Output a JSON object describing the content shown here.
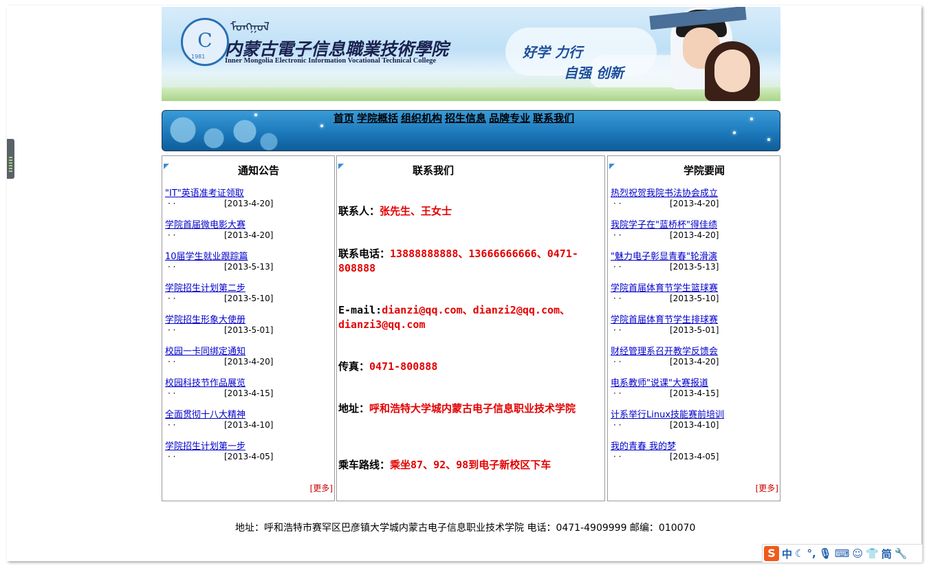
{
  "banner": {
    "cn_college": "内蒙古電子信息職業技術學院",
    "en_college": "Inner Mongolia Electronic Information Vocational Technical College",
    "seal_year": "1981",
    "slogan_1": "好学 力行",
    "slogan_2": "自强 创新"
  },
  "nav": {
    "items": [
      "首页",
      "学院概括",
      "组织机构",
      "招生信息",
      "品牌专业",
      "联系我们"
    ]
  },
  "notices": {
    "title": "通知公告",
    "more": "[更多]",
    "items": [
      {
        "title": "\"IT\"英语准考证领取",
        "date": "[2013-4-20]"
      },
      {
        "title": "学院首届微电影大赛",
        "date": "[2013-4-20]"
      },
      {
        "title": "10届学生就业跟踪篇",
        "date": "[2013-5-13]"
      },
      {
        "title": "学院招生计划第二步",
        "date": "[2013-5-10]"
      },
      {
        "title": "学院招生形象大使册",
        "date": "[2013-5-01]"
      },
      {
        "title": "校园一卡同绑定通知",
        "date": "[2013-4-20]"
      },
      {
        "title": "校园科技节作品展览",
        "date": "[2013-4-15]"
      },
      {
        "title": "全面贯彻十八大精神",
        "date": "[2013-4-10]"
      },
      {
        "title": "学院招生计划第一步",
        "date": "[2013-4-05]"
      }
    ]
  },
  "contact": {
    "title": "联系我们",
    "person_label": "联系人：",
    "person_value": "张先生、王女士",
    "phone_label": "联系电话：",
    "phone_value": "13888888888、13666666666、0471-808888",
    "email_label": "E-mail:",
    "email_value": "dianzi@qq.com、dianzi2@qq.com、dianzi3@qq.com",
    "fax_label": "传真：",
    "fax_value": "0471-800888",
    "address_label": "地址：",
    "address_value": "呼和浩特大学城内蒙古电子信息职业技术学院",
    "route_label": "乘车路线：",
    "route_value": "乘坐87、92、98到电子新校区下车"
  },
  "news": {
    "title": "学院要闻",
    "more": "[更多]",
    "items": [
      {
        "title": "热烈祝贺我院书法协会成立",
        "date": "[2013-4-20]"
      },
      {
        "title": "我院学子在\"蓝桥杯\"得佳绩",
        "date": "[2013-4-20]"
      },
      {
        "title": "\"魅力电子彰显青春\"轮滑演",
        "date": "[2013-5-13]"
      },
      {
        "title": "学院首届体育节学生篮球赛",
        "date": "[2013-5-10]"
      },
      {
        "title": "学院首届体育节学生排球赛",
        "date": "[2013-5-01]"
      },
      {
        "title": "财经管理系召开教学反馈会",
        "date": "[2013-4-20]"
      },
      {
        "title": "电系教师\"说课\"大赛报道",
        "date": "[2013-4-15]"
      },
      {
        "title": "计系举行Linux技能赛前培训",
        "date": "[2013-4-10]"
      },
      {
        "title": "我的青春 我的梦",
        "date": "[2013-4-05]"
      }
    ]
  },
  "footer": {
    "text": "地址：呼和浩特市赛罕区巴彦镇大学城内蒙古电子信息职业技术学院 电话：0471-4909999  邮编：010070"
  },
  "ime": {
    "logo": "S",
    "lang": "中",
    "simplified": "简"
  }
}
